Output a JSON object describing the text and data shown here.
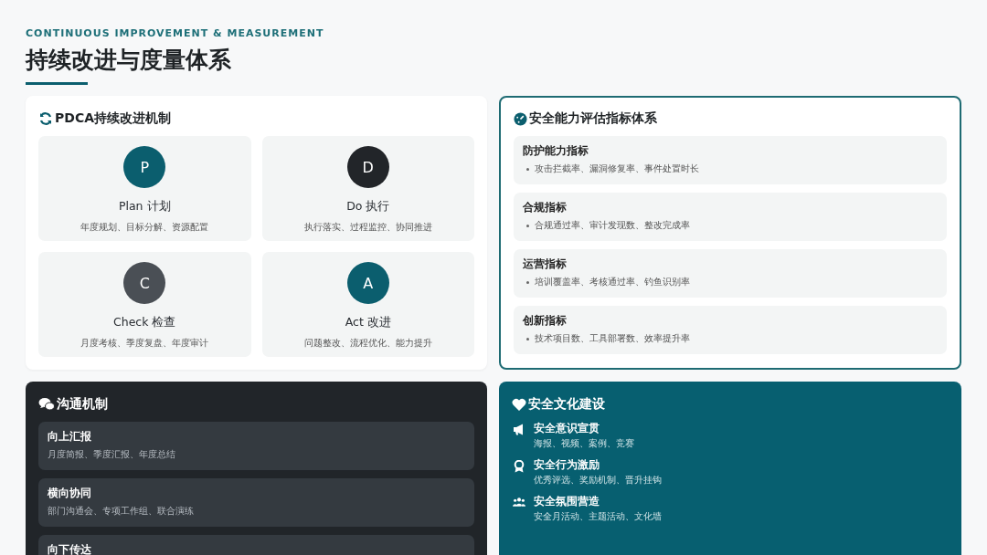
{
  "header": {
    "eyebrow": "CONTINUOUS IMPROVEMENT & MEASUREMENT",
    "title": "持续改进与度量体系"
  },
  "pdca": {
    "title": "PDCA持续改进机制",
    "steps": [
      {
        "letter": "P",
        "color": "#0b5e6e",
        "name": "Plan 计划",
        "desc": "年度规划、目标分解、资源配置"
      },
      {
        "letter": "D",
        "color": "#222529",
        "name": "Do 执行",
        "desc": "执行落实、过程监控、协同推进"
      },
      {
        "letter": "C",
        "color": "#4a4f55",
        "name": "Check 检查",
        "desc": "月度考核、季度复盘、年度审计"
      },
      {
        "letter": "A",
        "color": "#0b5e6e",
        "name": "Act 改进",
        "desc": "问题整改、流程优化、能力提升"
      }
    ]
  },
  "metrics": {
    "title": "安全能力评估指标体系",
    "items": [
      {
        "title": "防护能力指标",
        "detail": "攻击拦截率、漏洞修复率、事件处置时长"
      },
      {
        "title": "合规指标",
        "detail": "合规通过率、审计发现数、整改完成率"
      },
      {
        "title": "运营指标",
        "detail": "培训覆盖率、考核通过率、钓鱼识别率"
      },
      {
        "title": "创新指标",
        "detail": "技术项目数、工具部署数、效率提升率"
      }
    ]
  },
  "communication": {
    "title": "沟通机制",
    "items": [
      {
        "title": "向上汇报",
        "detail": "月度简报、季度汇报、年度总结"
      },
      {
        "title": "横向协同",
        "detail": "部门沟通会、专项工作组、联合演练"
      },
      {
        "title": "向下传达"
      }
    ]
  },
  "culture": {
    "title": "安全文化建设",
    "items": [
      {
        "kind": "megaphone",
        "title": "安全意识宣贯",
        "detail": "海报、视频、案例、竞赛"
      },
      {
        "kind": "award",
        "title": "安全行为激励",
        "detail": "优秀评选、奖励机制、晋升挂钩"
      },
      {
        "kind": "people",
        "title": "安全氛围营造",
        "detail": "安全月活动、主题活动、文化墙"
      }
    ]
  }
}
